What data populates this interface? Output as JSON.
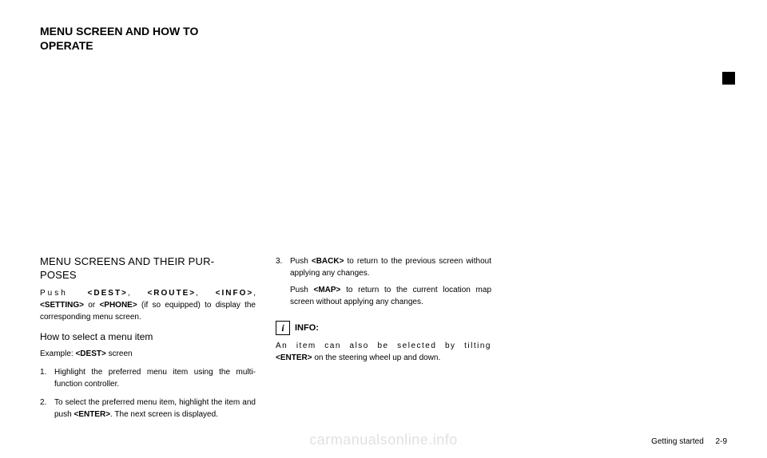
{
  "header": {
    "line1": "MENU SCREEN AND HOW TO",
    "line2": "OPERATE"
  },
  "col1": {
    "title": "MENU SCREENS AND THEIR PUR-\nPOSES",
    "para1_pre": "Push ",
    "para1_dest": "<DEST>",
    "para1_c1": ", ",
    "para1_route": "<ROUTE>",
    "para1_c2": ", ",
    "para1_info": "<INFO>",
    "para1_c3": ", ",
    "para1_setting": "<SETTING>",
    "para1_or": " or ",
    "para1_phone": "<PHONE>",
    "para1_tail": " (if so equipped) to display the corresponding menu screen.",
    "subheading": "How to select a menu item",
    "example_pre": "Example: ",
    "example_bold": "<DEST>",
    "example_post": " screen",
    "item1_num": "1.",
    "item1_text": "Highlight the preferred menu item using the multi-function controller.",
    "item2_num": "2.",
    "item2_pre": "To select the preferred menu item, highlight the item and push ",
    "item2_bold": "<ENTER>",
    "item2_post": ". The next screen is displayed."
  },
  "col2": {
    "item3_num": "3.",
    "item3_a_pre": "Push ",
    "item3_a_bold": "<BACK>",
    "item3_a_post": " to return to the previous screen without applying any changes.",
    "item3_b_pre": "Push ",
    "item3_b_bold": "<MAP>",
    "item3_b_post": " to return to the current location map screen without applying any changes.",
    "info_symbol": "i",
    "info_label": "INFO:",
    "info_text_pre": "An item can also be selected by tilting ",
    "info_text_bold": "<ENTER>",
    "info_text_post": " on the steering wheel up and down."
  },
  "footer": {
    "section": "Getting started",
    "page": "2-9"
  },
  "watermark": "carmanualsonline.info"
}
